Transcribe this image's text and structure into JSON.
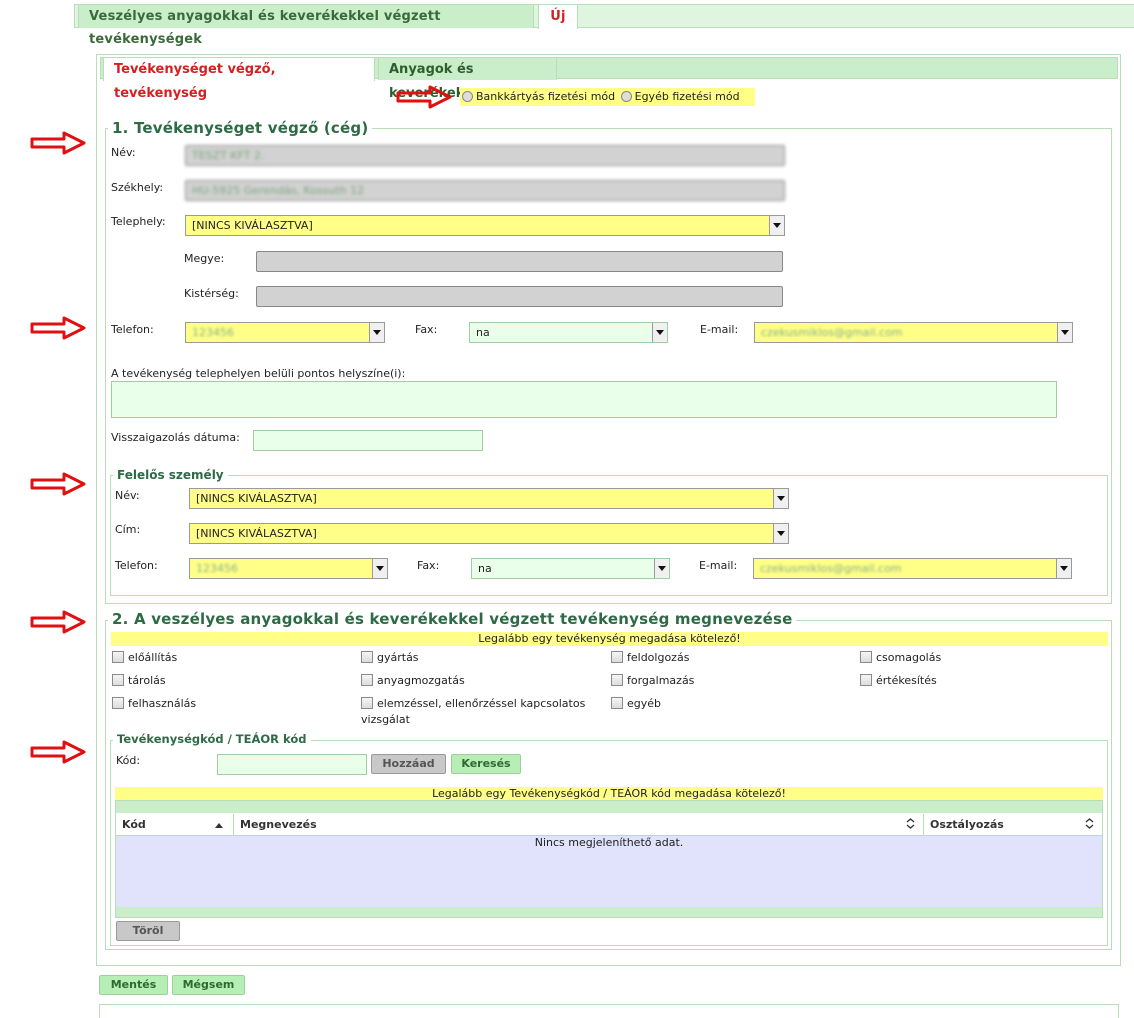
{
  "top_tabs": {
    "activities": "Veszélyes anyagokkal és keverékekkel végzett tevékenységek",
    "new": "Új"
  },
  "inner_tabs": {
    "actor": "Tevékenységet végző, tevékenység",
    "materials": "Anyagok és keverékek"
  },
  "payment": {
    "card": "Bankkártyás fizetési mód",
    "other": "Egyéb fizetési mód"
  },
  "section1": {
    "title": "1. Tevékenységet végző (cég)",
    "name_label": "Név:",
    "name_value": "TESZT KFT 2.",
    "seat_label": "Székhely:",
    "seat_value": "HU-5925 Gerendás, Kossuth 12",
    "site_label": "Telephely:",
    "site_value": "[NINCS KIVÁLASZTVA]",
    "county_label": "Megye:",
    "subregion_label": "Kistérség:",
    "phone_label": "Telefon:",
    "phone_value": "123456",
    "fax_label": "Fax:",
    "fax_value": "na",
    "email_label": "E-mail:",
    "email_value": "czekusmiklos@gmail.com",
    "location_label": "A tevékenység telephelyen belüli pontos helyszíne(i):",
    "confirm_date_label": "Visszaigazolás dátuma:"
  },
  "responsible": {
    "title": "Felelős személy",
    "name_label": "Név:",
    "name_value": "[NINCS KIVÁLASZTVA]",
    "address_label": "Cím:",
    "address_value": "[NINCS KIVÁLASZTVA]",
    "phone_label": "Telefon:",
    "phone_value": "123456",
    "fax_label": "Fax:",
    "fax_value": "na",
    "email_label": "E-mail:",
    "email_value": "czekusmiklos@gmail.com"
  },
  "section2": {
    "title": "2. A veszélyes anyagokkal és keverékekkel végzett tevékenység megnevezése",
    "required_note": "Legalább egy tevékenység megadása kötelező!",
    "activities": [
      "előállítás",
      "gyártás",
      "feldolgozás",
      "csomagolás",
      "tárolás",
      "anyagmozgatás",
      "forgalmazás",
      "értékesítés",
      "felhasználás",
      "elemzéssel, ellenőrzéssel kapcsolatos vizsgálat",
      "egyéb"
    ]
  },
  "teaor": {
    "title": "Tevékenységkód / TEÁOR kód",
    "code_label": "Kód:",
    "add_button": "Hozzáad",
    "search_button": "Keresés",
    "required_note": "Legalább egy Tevékenységkód / TEÁOR kód megadása kötelező!",
    "columns": [
      "Kód",
      "Megnevezés",
      "Osztályozás"
    ],
    "empty_text": "Nincs megjeleníthető adat.",
    "delete_button": "Töröl"
  },
  "footer": {
    "save": "Mentés",
    "cancel": "Mégsem"
  },
  "colors": {
    "accent_green": "#2e6a45",
    "required_yellow": "#ffff88",
    "active_tab_red": "#d42020",
    "annotation_arrow_red": "#e01010"
  }
}
